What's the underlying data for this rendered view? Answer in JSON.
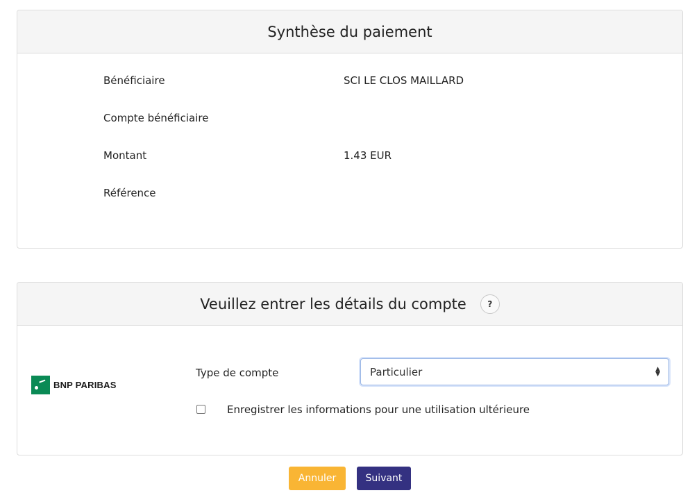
{
  "summary": {
    "title": "Synthèse du paiement",
    "rows": [
      {
        "label": "Bénéficiaire",
        "value": "SCI LE CLOS MAILLARD"
      },
      {
        "label": "Compte bénéficiaire",
        "value": ""
      },
      {
        "label": "Montant",
        "value": "1.43 EUR"
      },
      {
        "label": "Référence",
        "value": ""
      }
    ]
  },
  "details": {
    "title": "Veuillez entrer les détails du compte",
    "help_label": "?",
    "bank_name": "BNP PARIBAS",
    "account_type_label": "Type de compte",
    "account_type_value": "Particulier",
    "save_label": "Enregistrer les informations pour une utilisation ultérieure",
    "save_checked": false
  },
  "actions": {
    "cancel_label": "Annuler",
    "next_label": "Suivant"
  },
  "colors": {
    "cancel": "#f9b534",
    "next": "#343181",
    "bank_green": "#0a8a55"
  }
}
